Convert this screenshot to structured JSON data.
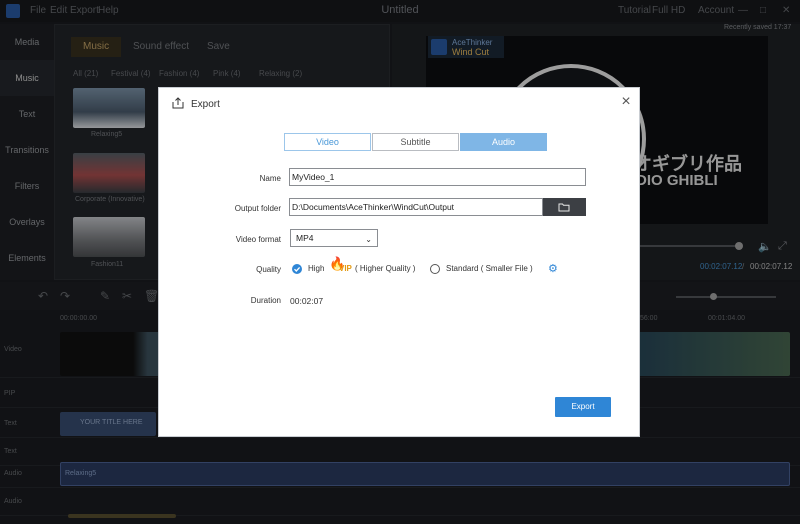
{
  "app": {
    "title": "Untitled",
    "menu": [
      "File",
      "Edit",
      "Export",
      "Help"
    ],
    "right_menu": [
      "Tutorial",
      "Full HD",
      "Account"
    ],
    "saved_text": "Recently saved 17:37"
  },
  "left_nav": {
    "items": [
      "Media",
      "Music",
      "Text",
      "Transitions",
      "Filters",
      "Overlays",
      "Elements"
    ],
    "active": "Music"
  },
  "media_panel": {
    "tabs": [
      "Music",
      "Sound effect",
      "Save"
    ],
    "active_tab": "Music",
    "filters": [
      "All (21)",
      "Festival (4)",
      "Fashion (4)",
      "Pink (4)",
      "Relaxing (2)"
    ],
    "thumbs": [
      "Relaxing5",
      "Corporate (Innovative)",
      "Fashion11"
    ]
  },
  "preview": {
    "badge_brand": "AceThinker",
    "badge_app": "Wind Cut",
    "overlay_jp": "オギブリ作品",
    "overlay_en": "DIO GHIBLI",
    "time_current": "00:02:07.12",
    "time_sep": "/",
    "time_total": "00:02:07.12"
  },
  "timeline": {
    "ruler_start": "00:00:00.00",
    "ruler_mid": ":56:00",
    "ruler_end": "00:01:04.00",
    "tracks": [
      "Video",
      "PIP",
      "Text",
      "Text",
      "Audio",
      "Audio"
    ],
    "text_clip": "YOUR TITLE HERE",
    "audio_clip": "Relaxing5"
  },
  "dialog": {
    "title": "Export",
    "tabs": [
      "Video",
      "Subtitle",
      "Audio"
    ],
    "active_tab": "Audio",
    "name_label": "Name",
    "name_value": "MyVideo_1",
    "output_label": "Output folder",
    "output_value": "D:\\Documents\\AceThinker\\WindCut\\Output",
    "format_label": "Video format",
    "format_value": "MP4",
    "quality_label": "Quality",
    "quality_high": "High",
    "quality_vip": "VIP",
    "quality_high_desc": "( Higher Quality )",
    "quality_std": "Standard ( Smaller File )",
    "quality_selected": "High",
    "duration_label": "Duration",
    "duration_value": "00:02:07",
    "export_button": "Export"
  },
  "colors": {
    "accent": "#2f86d6",
    "tab_active": "#7fb6e6",
    "vip": "#e39a12",
    "gold_tab": "#c9a86a"
  }
}
